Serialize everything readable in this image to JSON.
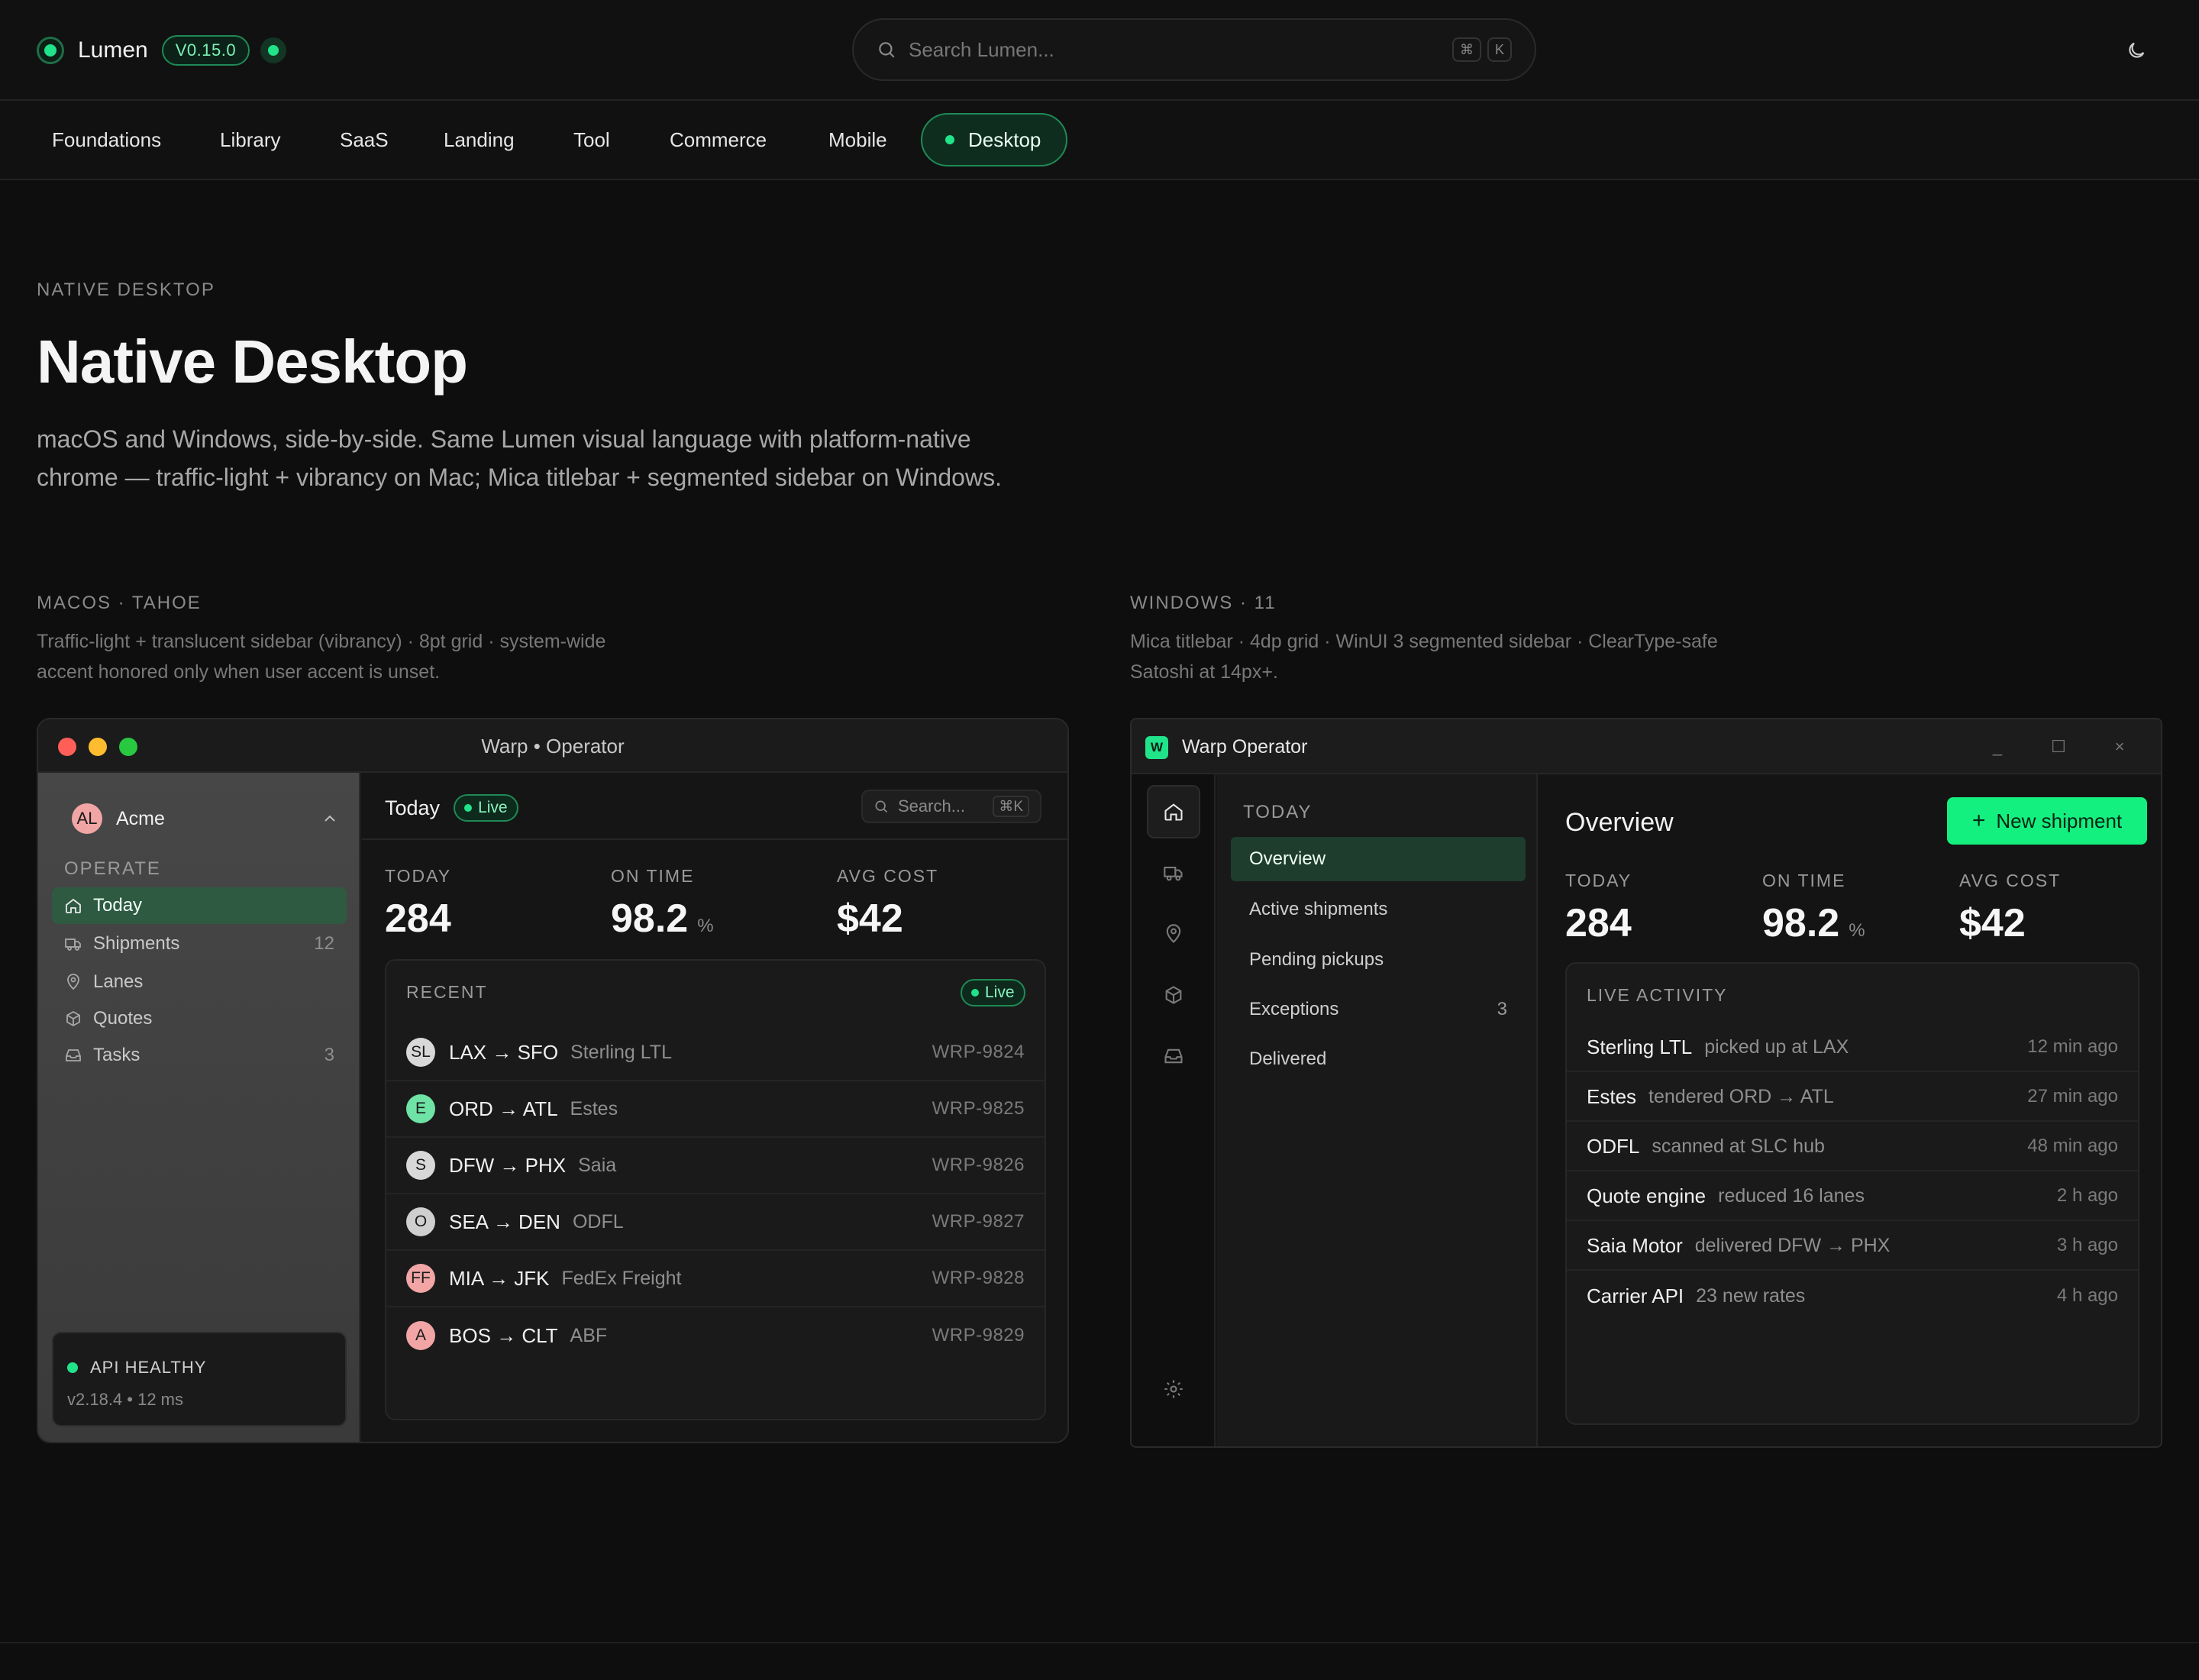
{
  "header": {
    "brand": "Lumen",
    "version": "V0.15.0",
    "search_placeholder": "Search Lumen...",
    "kbd": [
      "⌘",
      "K"
    ]
  },
  "nav": {
    "tabs": [
      "Foundations",
      "Library",
      "SaaS",
      "Landing",
      "Tool",
      "Commerce",
      "Mobile",
      "Desktop"
    ],
    "active": "Desktop"
  },
  "hero": {
    "eyebrow": "NATIVE DESKTOP",
    "title": "Native Desktop",
    "desc_line1": "macOS and Windows, side-by-side. Same Lumen visual language with platform-native",
    "desc_line2": "chrome — traffic-light + vibrancy on Mac; Mica titlebar + segmented sidebar on Windows."
  },
  "mac_section": {
    "label": "MACOS · TAHOE",
    "desc_line1": "Traffic-light + translucent sidebar (vibrancy) · 8pt grid · system-wide",
    "desc_line2": "accent honored only when user accent is unset."
  },
  "win_section": {
    "label": "WINDOWS · 11",
    "desc_line1": "Mica titlebar · 4dp grid · WinUI 3 segmented sidebar · ClearType-safe",
    "desc_line2": "Satoshi at 14px+."
  },
  "mac": {
    "window_title": "Warp • Operator",
    "account": {
      "initials": "AL",
      "name": "Acme"
    },
    "group": "OPERATE",
    "sidebar": [
      {
        "label": "Today",
        "count": "",
        "icon": "home-icon"
      },
      {
        "label": "Shipments",
        "count": "12",
        "icon": "truck-icon"
      },
      {
        "label": "Lanes",
        "count": "",
        "icon": "map-pin-icon"
      },
      {
        "label": "Quotes",
        "count": "",
        "icon": "box-icon"
      },
      {
        "label": "Tasks",
        "count": "3",
        "icon": "inbox-icon"
      }
    ],
    "api": {
      "status": "API HEALTHY",
      "meta": "v2.18.4 • 12 ms"
    },
    "toolbar": {
      "title": "Today",
      "live": "Live",
      "search": "Search...",
      "kbd": "⌘K"
    },
    "stats": [
      {
        "label": "TODAY",
        "value": "284",
        "unit": ""
      },
      {
        "label": "ON TIME",
        "value": "98.2",
        "unit": "%"
      },
      {
        "label": "AVG COST",
        "value": "$42",
        "unit": ""
      }
    ],
    "recent": {
      "title": "RECENT",
      "live": "Live",
      "rows": [
        {
          "initials": "SL",
          "color": "#d8d8d8",
          "route": "LAX → SFO",
          "carrier": "Sterling LTL",
          "code": "WRP-9824"
        },
        {
          "initials": "E",
          "color": "#6fe3a6",
          "route": "ORD → ATL",
          "carrier": "Estes",
          "code": "WRP-9825"
        },
        {
          "initials": "S",
          "color": "#d8d8d8",
          "route": "DFW → PHX",
          "carrier": "Saia",
          "code": "WRP-9826"
        },
        {
          "initials": "O",
          "color": "#cfcfcf",
          "route": "SEA → DEN",
          "carrier": "ODFL",
          "code": "WRP-9827"
        },
        {
          "initials": "FF",
          "color": "#f1a5a5",
          "route": "MIA → JFK",
          "carrier": "FedEx Freight",
          "code": "WRP-9828"
        },
        {
          "initials": "A",
          "color": "#f1a5a5",
          "route": "BOS → CLT",
          "carrier": "ABF",
          "code": "WRP-9829"
        }
      ]
    }
  },
  "win": {
    "window_title": "Warp Operator",
    "logo": "W",
    "controls": [
      "_",
      "☐",
      "×"
    ],
    "nav_head": "TODAY",
    "nav": [
      {
        "label": "Overview",
        "count": ""
      },
      {
        "label": "Active shipments",
        "count": ""
      },
      {
        "label": "Pending pickups",
        "count": ""
      },
      {
        "label": "Exceptions",
        "count": "3"
      },
      {
        "label": "Delivered",
        "count": ""
      }
    ],
    "title": "Overview",
    "new_button": "New shipment",
    "stats": [
      {
        "label": "TODAY",
        "value": "284",
        "unit": ""
      },
      {
        "label": "ON TIME",
        "value": "98.2",
        "unit": "%"
      },
      {
        "label": "AVG COST",
        "value": "$42",
        "unit": ""
      }
    ],
    "activity": {
      "title": "LIVE ACTIVITY",
      "rows": [
        {
          "who": "Sterling LTL",
          "what": "picked up at LAX",
          "when": "12 min ago"
        },
        {
          "who": "Estes",
          "what": "tendered ORD → ATL",
          "when": "27 min ago"
        },
        {
          "who": "ODFL",
          "what": "scanned at SLC hub",
          "when": "48 min ago"
        },
        {
          "who": "Quote engine",
          "what": "reduced 16 lanes",
          "when": "2 h ago"
        },
        {
          "who": "Saia Motor",
          "what": "delivered DFW → PHX",
          "when": "3 h ago"
        },
        {
          "who": "Carrier API",
          "what": "23 new rates",
          "when": "4 h ago"
        }
      ]
    }
  },
  "colors": {
    "accent": "#20e38a",
    "button": "#14f07f",
    "bg": "#0e0e0e"
  }
}
